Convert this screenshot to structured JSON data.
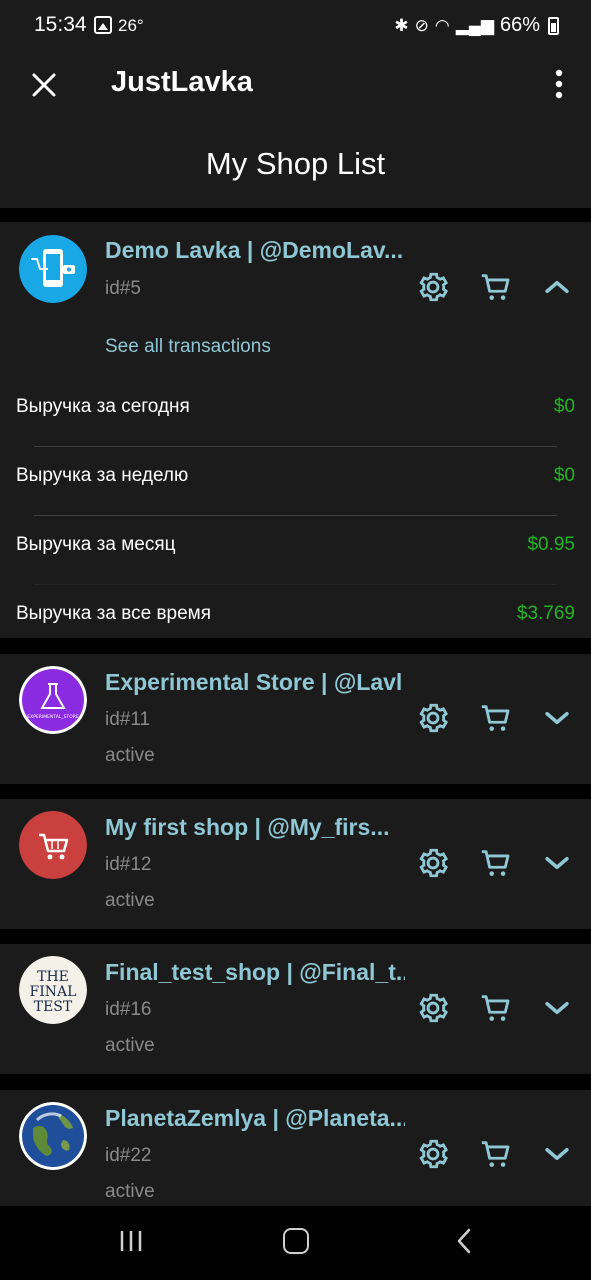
{
  "status_bar": {
    "time": "15:34",
    "temperature": "26°",
    "battery": "66%"
  },
  "app_bar": {
    "title": "JustLavka"
  },
  "page": {
    "title": "My Shop List"
  },
  "shops": [
    {
      "name": "Demo Lavka | @DemoLav...",
      "id": "id#5",
      "expanded": true,
      "see_all": "See all transactions",
      "revenue": [
        {
          "label": "Выручка за сегодня",
          "value": "$0"
        },
        {
          "label": "Выручка за неделю",
          "value": "$0"
        },
        {
          "label": "Выручка за месяц",
          "value": "$0.95"
        },
        {
          "label": "Выручка за все время",
          "value": "$3.769"
        }
      ]
    },
    {
      "name": "Experimental Store | @Lavl",
      "id": "id#11",
      "status": "active",
      "logo_text": "EXPERIMENTAL_STORE"
    },
    {
      "name": "My first shop | @My_firs...",
      "id": "id#12",
      "status": "active"
    },
    {
      "name": "Final_test_shop | @Final_t...",
      "id": "id#16",
      "status": "active",
      "logo_text": [
        "THE",
        "FINAL",
        "TEST"
      ]
    },
    {
      "name": "PlanetaZemlya | @Planeta...",
      "id": "id#22",
      "status": "active"
    }
  ],
  "colors": {
    "accent": "#8fc7d4",
    "revenue_green": "#22b422",
    "card_bg": "#1b1b1b",
    "secondary_text": "#8a8a8a"
  },
  "icons": [
    "close-icon",
    "more-vert-icon",
    "gear-icon",
    "cart-icon",
    "chevron-up-icon",
    "chevron-down-icon"
  ]
}
